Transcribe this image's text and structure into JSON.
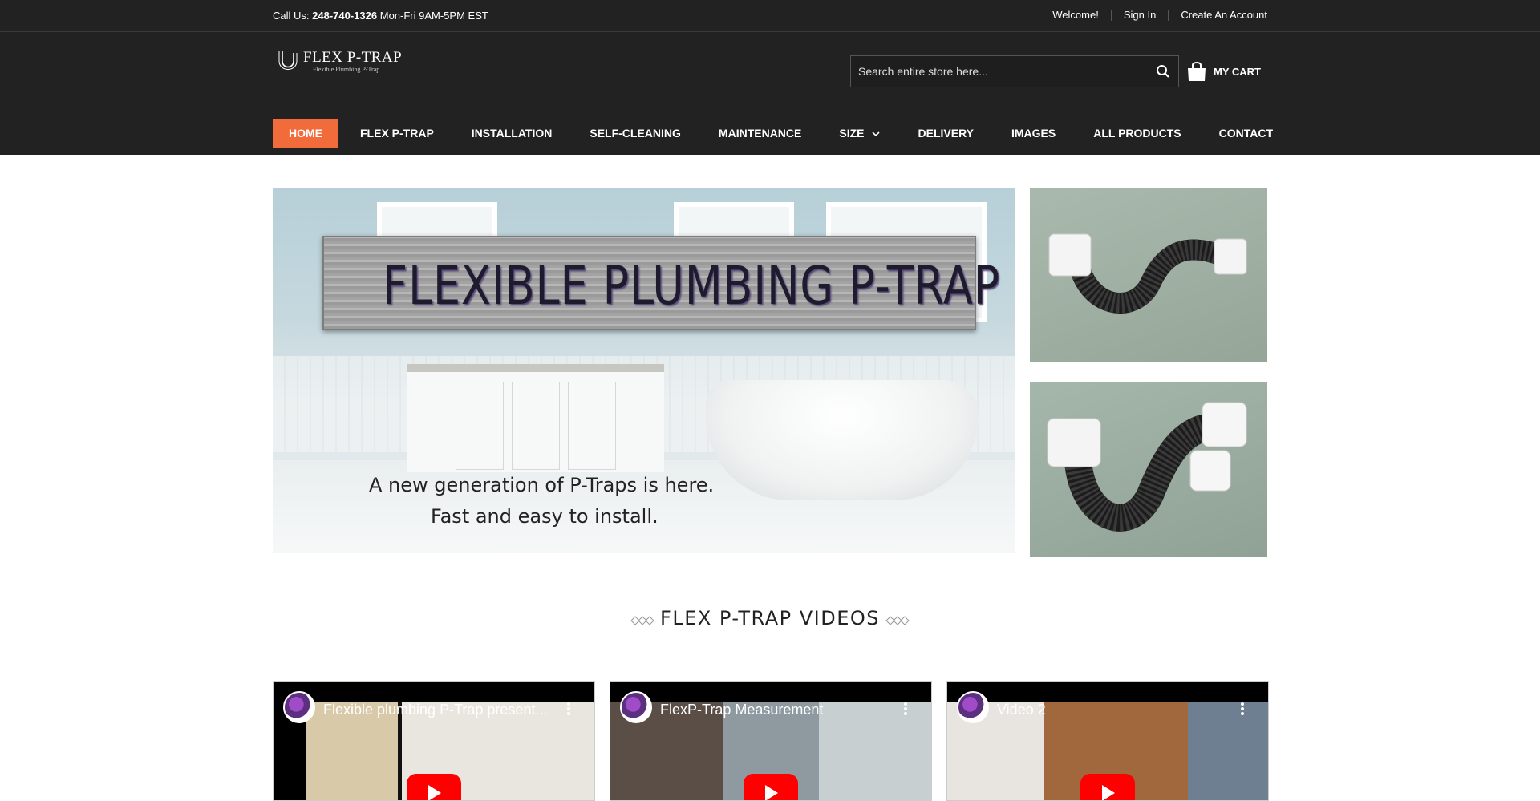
{
  "topbar": {
    "call_prefix": "Call Us:",
    "phone": "248-740-1326",
    "hours": "Mon-Fri 9AM-5PM EST",
    "welcome": "Welcome!",
    "sign_in": "Sign In",
    "create_account": "Create An Account"
  },
  "header": {
    "logo_name": "FLEX P-TRAP",
    "logo_tagline": "Flexible Plumbing P-Trap",
    "search_placeholder": "Search entire store here...",
    "cart_label": "MY CART"
  },
  "nav": {
    "items": [
      {
        "label": "HOME",
        "active": true
      },
      {
        "label": "FLEX P-TRAP"
      },
      {
        "label": "INSTALLATION"
      },
      {
        "label": "SELF-CLEANING"
      },
      {
        "label": "MAINTENANCE"
      },
      {
        "label": "SIZE",
        "has_dropdown": true
      },
      {
        "label": "DELIVERY"
      },
      {
        "label": "IMAGES"
      },
      {
        "label": "ALL PRODUCTS"
      },
      {
        "label": "CONTACT"
      }
    ]
  },
  "hero": {
    "banner": "FLEXIBLE PLUMBING P-TRAP",
    "caption_line1": "A new generation of P-Traps is here.",
    "caption_line2": "Fast and easy to install."
  },
  "videos_section": {
    "title": "FLEX P-TRAP VIDEOS",
    "videos": [
      {
        "title": "Flexible plumbing P-Trap present..."
      },
      {
        "title": "FlexP-Trap Measurement"
      },
      {
        "title": "Video 2"
      }
    ]
  },
  "colors": {
    "dark_bg": "#222222",
    "accent": "#f26b3a",
    "youtube_red": "#ff0000"
  }
}
